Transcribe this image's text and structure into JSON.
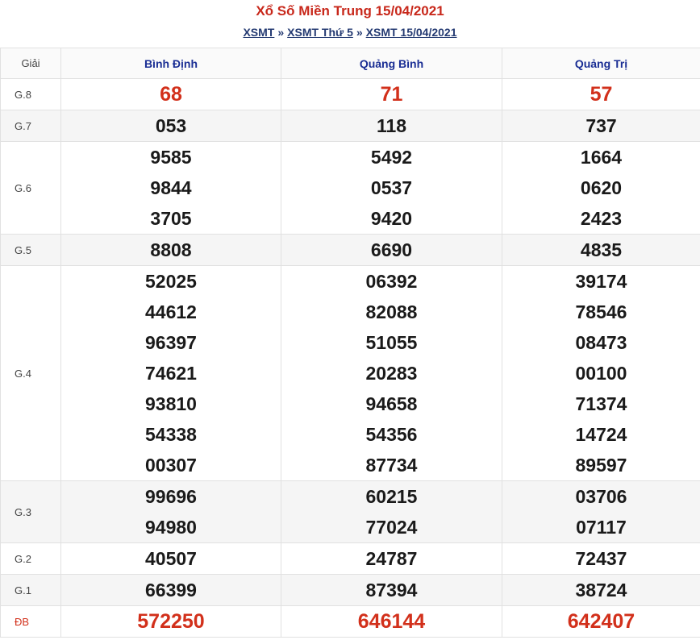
{
  "title": "Xổ Số Miền Trung 15/04/2021",
  "breadcrumb": {
    "items": [
      "XSMT",
      "XSMT Thứ 5",
      "XSMT 15/04/2021"
    ],
    "separator": "»"
  },
  "table": {
    "header": [
      "Giải",
      "Bình Định",
      "Quảng Bình",
      "Quảng Trị"
    ],
    "rows": [
      {
        "prize": "G.8",
        "cols": [
          [
            "68"
          ],
          [
            "71"
          ],
          [
            "57"
          ]
        ]
      },
      {
        "prize": "G.7",
        "cols": [
          [
            "053"
          ],
          [
            "118"
          ],
          [
            "737"
          ]
        ]
      },
      {
        "prize": "G.6",
        "cols": [
          [
            "9585",
            "9844",
            "3705"
          ],
          [
            "5492",
            "0537",
            "9420"
          ],
          [
            "1664",
            "0620",
            "2423"
          ]
        ]
      },
      {
        "prize": "G.5",
        "cols": [
          [
            "8808"
          ],
          [
            "6690"
          ],
          [
            "4835"
          ]
        ]
      },
      {
        "prize": "G.4",
        "cols": [
          [
            "52025",
            "44612",
            "96397",
            "74621",
            "93810",
            "54338",
            "00307"
          ],
          [
            "06392",
            "82088",
            "51055",
            "20283",
            "94658",
            "54356",
            "87734"
          ],
          [
            "39174",
            "78546",
            "08473",
            "00100",
            "71374",
            "14724",
            "89597"
          ]
        ]
      },
      {
        "prize": "G.3",
        "cols": [
          [
            "99696",
            "94980"
          ],
          [
            "60215",
            "77024"
          ],
          [
            "03706",
            "07117"
          ]
        ]
      },
      {
        "prize": "G.2",
        "cols": [
          [
            "40507"
          ],
          [
            "24787"
          ],
          [
            "72437"
          ]
        ]
      },
      {
        "prize": "G.1",
        "cols": [
          [
            "66399"
          ],
          [
            "87394"
          ],
          [
            "38724"
          ]
        ]
      },
      {
        "prize": "ĐB",
        "cols": [
          [
            "572250"
          ],
          [
            "646144"
          ],
          [
            "642407"
          ]
        ]
      }
    ]
  },
  "colors": {
    "title": "#c8281b",
    "highlight": "#d2301b",
    "header": "#1a2e94",
    "link": "#243a72"
  }
}
